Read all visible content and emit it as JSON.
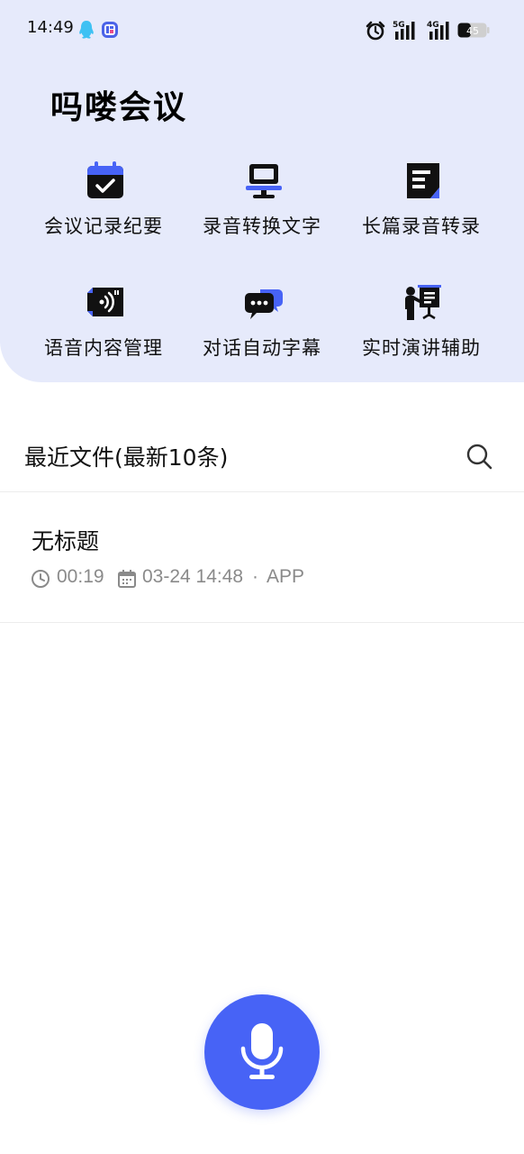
{
  "status_bar": {
    "time": "14:49",
    "icons": [
      "qq-icon",
      "tieba-icon",
      "alarm-icon",
      "signal-5g-icon",
      "signal-4g-icon",
      "battery-icon"
    ],
    "net1": "5G",
    "net2": "4G",
    "battery": "45",
    "battery_level": 0.45
  },
  "app": {
    "title": "吗喽会议"
  },
  "features": [
    {
      "label": "会议记录纪要",
      "icon": "calendar-check-icon"
    },
    {
      "label": "录音转换文字",
      "icon": "monitor-icon"
    },
    {
      "label": "长篇录音转录",
      "icon": "document-icon"
    },
    {
      "label": "语音内容管理",
      "icon": "voice-card-icon"
    },
    {
      "label": "对话自动字幕",
      "icon": "chat-bubbles-icon"
    },
    {
      "label": "实时演讲辅助",
      "icon": "presenter-icon"
    }
  ],
  "recent": {
    "title": "最近文件(最新10条)",
    "search_icon": "search-icon",
    "items": [
      {
        "name": "无标题",
        "duration": "00:19",
        "date": "03-24 14:48",
        "separator": "·",
        "source": "APP"
      }
    ]
  },
  "mic": {
    "icon": "microphone-icon"
  },
  "colors": {
    "accent": "#4763f6",
    "header_bg": "#e6eafb",
    "meta": "#8a8a8a"
  }
}
